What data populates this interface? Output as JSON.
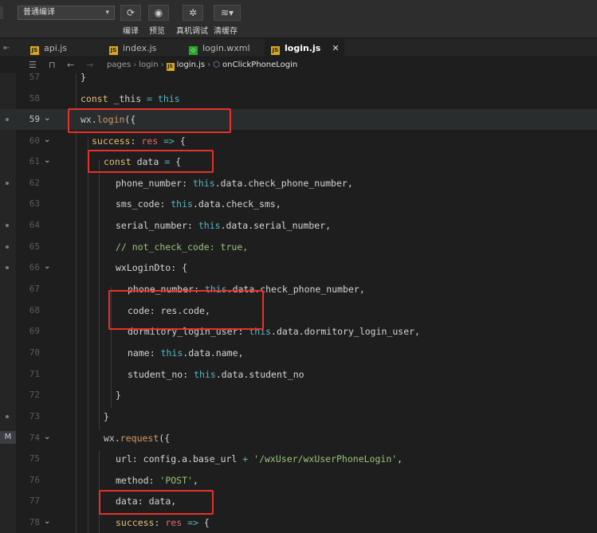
{
  "toolbar": {
    "compile_mode": "普通编译",
    "labels": [
      "编译",
      "预览",
      "真机调试",
      "清缓存"
    ]
  },
  "tabs": [
    {
      "name": "api.js",
      "icon": "js"
    },
    {
      "name": "index.js",
      "icon": "js"
    },
    {
      "name": "login.wxml",
      "icon": "wxml"
    },
    {
      "name": "login.js",
      "icon": "js",
      "active": true
    }
  ],
  "breadcrumb": {
    "path": [
      "pages",
      "login",
      "login.js",
      "onClickPhoneLogin"
    ]
  },
  "editor": {
    "current_line": 59,
    "gutter_badge": "M",
    "lines": [
      {
        "n": "57",
        "text": "}"
      },
      {
        "n": "58",
        "text": "const _this = this"
      },
      {
        "n": "59",
        "text": "wx.login({"
      },
      {
        "n": "60",
        "text": "success: res => {"
      },
      {
        "n": "61",
        "text": "const data = {"
      },
      {
        "n": "62",
        "text": "phone_number: this.data.check_phone_number,"
      },
      {
        "n": "63",
        "text": "sms_code: this.data.check_sms,"
      },
      {
        "n": "64",
        "text": "serial_number: this.data.serial_number,"
      },
      {
        "n": "65",
        "text": "// not_check_code: true,"
      },
      {
        "n": "66",
        "text": "wxLoginDto: {"
      },
      {
        "n": "67",
        "text": "phone_number: this.data.check_phone_number,"
      },
      {
        "n": "68",
        "text": "code: res.code,"
      },
      {
        "n": "69",
        "text": "dormitory_login_user: this.data.dormitory_login_user,"
      },
      {
        "n": "70",
        "text": "name: this.data.name,"
      },
      {
        "n": "71",
        "text": "student_no: this.data.student_no"
      },
      {
        "n": "72",
        "text": "}"
      },
      {
        "n": "73",
        "text": "}"
      },
      {
        "n": "74",
        "text": "wx.request({"
      },
      {
        "n": "75",
        "text": "url: config.a.base_url + '/wxUser/wxUserPhoneLogin',"
      },
      {
        "n": "76",
        "text": "method: 'POST',"
      },
      {
        "n": "77",
        "text": "data: data,"
      },
      {
        "n": "78",
        "text": "success: res => {"
      }
    ]
  },
  "colors": {
    "annotation_box": "#e8312a",
    "editor_bg": "#1e1e1e",
    "keyword": "#e5c07b",
    "this_keyword": "#56b6c2",
    "string": "#98c379"
  }
}
